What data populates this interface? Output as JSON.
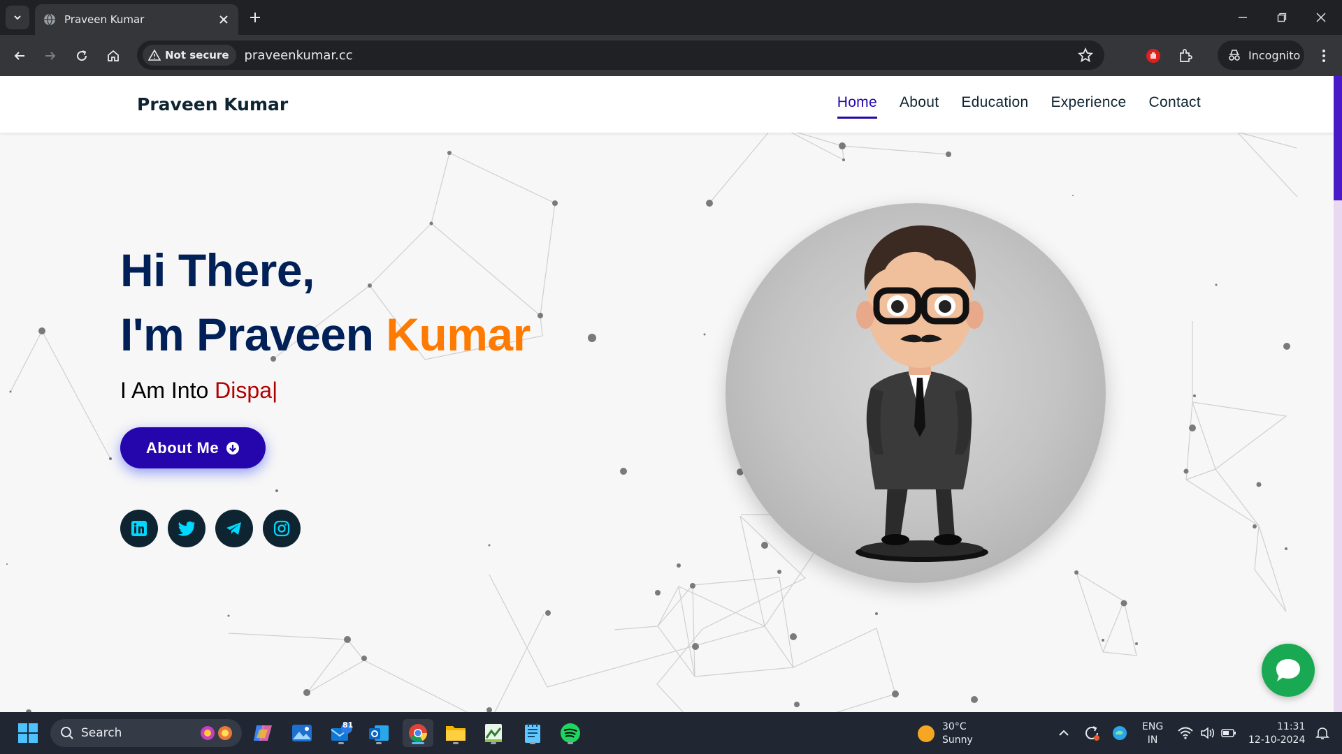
{
  "browser": {
    "tab_title": "Praveen Kumar",
    "security_chip": "Not secure",
    "url": "praveenkumar.cc",
    "profile_label": "Incognito"
  },
  "site": {
    "brand": "Praveen Kumar",
    "nav": [
      {
        "label": "Home",
        "active": true
      },
      {
        "label": "About",
        "active": false
      },
      {
        "label": "Education",
        "active": false
      },
      {
        "label": "Experience",
        "active": false
      },
      {
        "label": "Contact",
        "active": false
      }
    ],
    "hero": {
      "line1": "Hi There,",
      "line2_prefix": "I'm Praveen ",
      "line2_accent": "Kumar",
      "typing_prefix": "I Am Into ",
      "typing_word": "Dispa",
      "typing_caret": "|",
      "button_label": "About Me"
    },
    "socials": [
      "linkedin-icon",
      "twitter-icon",
      "telegram-icon",
      "instagram-icon"
    ],
    "colors": {
      "primary": "#2506ad",
      "accent": "#ff7a00",
      "heading": "#002057",
      "typing": "#b30000",
      "chat": "#1aa953"
    }
  },
  "taskbar": {
    "search_placeholder": "Search",
    "mail_badge": "81",
    "weather_temp": "30°C",
    "weather_desc": "Sunny",
    "lang_line1": "ENG",
    "lang_line2": "IN",
    "time": "11:31",
    "date": "12-10-2024"
  }
}
